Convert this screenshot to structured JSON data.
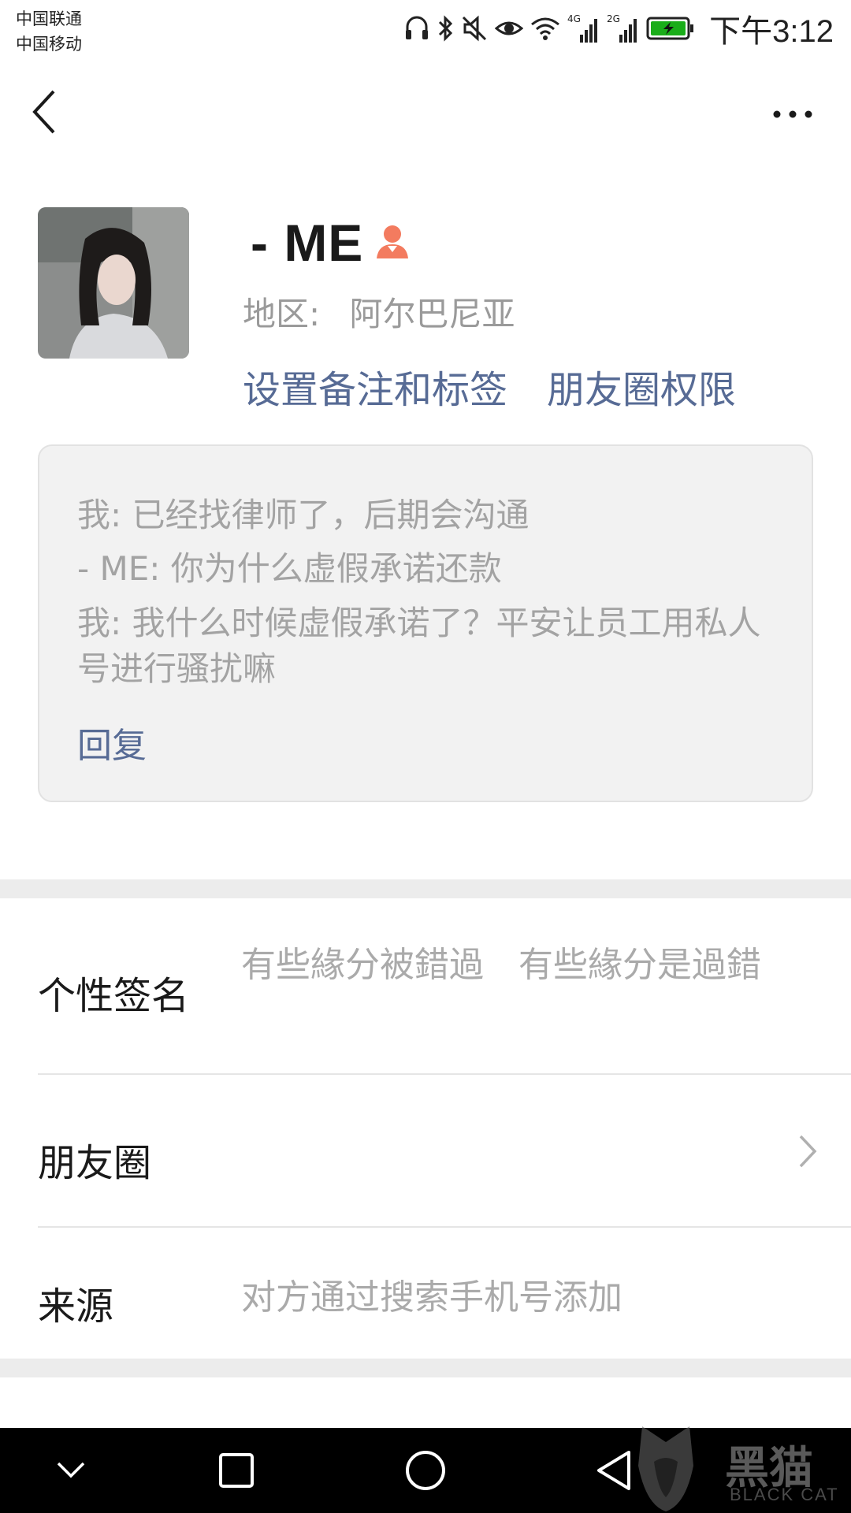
{
  "status_bar": {
    "carrier_1": "中国联通",
    "carrier_2": "中国移动",
    "network_1": "4G",
    "network_2": "2G",
    "time": "下午3:12",
    "icons": [
      "headphones-icon",
      "bluetooth-icon",
      "mute-icon",
      "eye-icon",
      "wifi-icon",
      "signal-icon",
      "signal-icon",
      "battery-charging-icon"
    ],
    "battery_color": "#1aad19"
  },
  "nav": {
    "back_icon": "chevron-left-icon",
    "more_icon": "more-dots-icon"
  },
  "profile": {
    "nickname": "- ME",
    "gender_icon": "female-icon",
    "gender_color": "#f37b5f",
    "region_label": "地区:",
    "region_value": "阿尔巴尼亚",
    "set_remark_link": "设置备注和标签",
    "moments_permission_link": "朋友圈权限"
  },
  "message_card": {
    "lines": [
      "我: 已经找律师了，后期会沟通",
      "- ME: 你为什么虚假承诺还款",
      "我: 我什么时候虚假承诺了？平安让员工用私人号进行骚扰嘛"
    ],
    "reply_link": "回复"
  },
  "rows": {
    "signature_label": "个性签名",
    "signature_value": "有些緣分被錯過　有些緣分是過錯",
    "moments_label": "朋友圈",
    "source_label": "来源",
    "source_value": "对方通过搜索手机号添加"
  },
  "watermark": {
    "text": "黑猫",
    "sub": "BLACK CAT"
  },
  "colors": {
    "link": "#576b95",
    "muted_text": "#a3a3a3"
  }
}
